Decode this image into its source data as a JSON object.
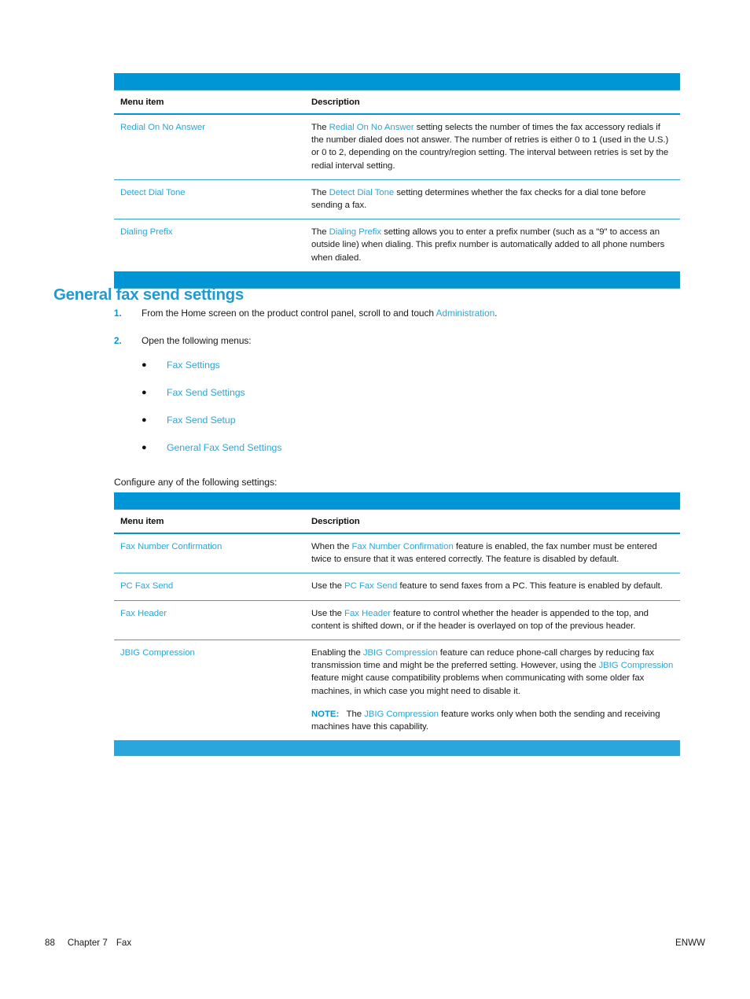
{
  "document": {
    "heading": "General fax send settings"
  },
  "table_one": {
    "headers": [
      "Menu item",
      "Description"
    ],
    "rows": [
      {
        "menu_item": "Redial On No Answer",
        "description_parts": [
          {
            "t": "The ",
            "link": false
          },
          {
            "t": "Redial On No Answer",
            "link": true
          },
          {
            "t": " setting selects the number of times the fax accessory redials if the number dialed does not answer. The number of retries is either 0 to 1 (used in the U.S.) or 0 to 2, depending on the country/region setting. The interval between retries is set by the redial interval setting.",
            "link": false
          }
        ]
      },
      {
        "menu_item": "Detect Dial Tone",
        "description_parts": [
          {
            "t": "The ",
            "link": false
          },
          {
            "t": "Detect Dial Tone",
            "link": true
          },
          {
            "t": " setting determines whether the fax checks for a dial tone before sending a fax.",
            "link": false
          }
        ]
      },
      {
        "menu_item": "Dialing Prefix",
        "description_parts": [
          {
            "t": "The ",
            "link": false
          },
          {
            "t": "Dialing Prefix",
            "link": true
          },
          {
            "t": " setting allows you to enter a prefix number (such as a \"9\" to access an outside line) when dialing. This prefix number is automatically added to all phone numbers when dialed.",
            "link": false
          }
        ]
      }
    ]
  },
  "steps": [
    {
      "number": "1.",
      "parts": [
        {
          "t": "From the Home screen on the product control panel, scroll to and touch ",
          "link": false
        },
        {
          "t": "Administration",
          "link": true
        },
        {
          "t": ".",
          "link": false
        }
      ]
    },
    {
      "number": "2.",
      "parts": [
        {
          "t": "Open the following menus:",
          "link": false
        }
      ]
    }
  ],
  "menu_path": {
    "bullet": "●",
    "items": [
      "Fax Settings",
      "Fax Send Settings",
      "Fax Send Setup",
      "General Fax Send Settings"
    ]
  },
  "configure_line": "Configure any of the following settings:",
  "table_two": {
    "headers": [
      "Menu item",
      "Description"
    ],
    "rows": [
      {
        "menu_item": "Fax Number Confirmation",
        "description_parts": [
          {
            "t": "When the ",
            "link": false
          },
          {
            "t": "Fax Number Confirmation",
            "link": true
          },
          {
            "t": " feature is enabled, the fax number must be entered twice to ensure that it was entered correctly. The feature is disabled by default.",
            "link": false
          }
        ]
      },
      {
        "menu_item": "PC Fax Send",
        "description_parts": [
          {
            "t": "Use the ",
            "link": false
          },
          {
            "t": "PC Fax Send",
            "link": true
          },
          {
            "t": " feature to send faxes from a PC. This feature is enabled by default.",
            "link": false
          }
        ]
      },
      {
        "menu_item": "Fax Header",
        "description_parts": [
          {
            "t": "Use the ",
            "link": false
          },
          {
            "t": "Fax Header",
            "link": true
          },
          {
            "t": " feature to control whether the header is appended to the top, and content is shifted down, or if the header is overlayed on top of the previous header.",
            "link": false
          }
        ]
      },
      {
        "menu_item": "JBIG Compression",
        "description_parts": [
          {
            "t": "Enabling the ",
            "link": false
          },
          {
            "t": "JBIG Compression",
            "link": true
          },
          {
            "t": " feature can reduce phone-call charges by reducing fax transmission time and might be the preferred setting. However, using the ",
            "link": false
          },
          {
            "t": "JBIG Compression",
            "link": true
          },
          {
            "t": " feature might cause compatibility problems when communicating with some older fax machines, in which case you might need to disable it.",
            "link": false
          }
        ],
        "note": {
          "label": "NOTE:",
          "parts": [
            {
              "t": "The ",
              "link": false
            },
            {
              "t": "JBIG Compression",
              "link": true
            },
            {
              "t": " feature works only when both the sending and receiving machines have this capability.",
              "link": false
            }
          ]
        }
      }
    ]
  },
  "footer": {
    "page_number": "88",
    "chapter": "Chapter 7",
    "chapter_title": "Fax",
    "locale": "ENWW"
  },
  "colors": {
    "hp_blue": "#0096d6",
    "link_blue": "#2aa6dd",
    "heading_blue": "#1e9ad6",
    "body_text": "#1a1a1a",
    "page_background": "#ffffff"
  }
}
